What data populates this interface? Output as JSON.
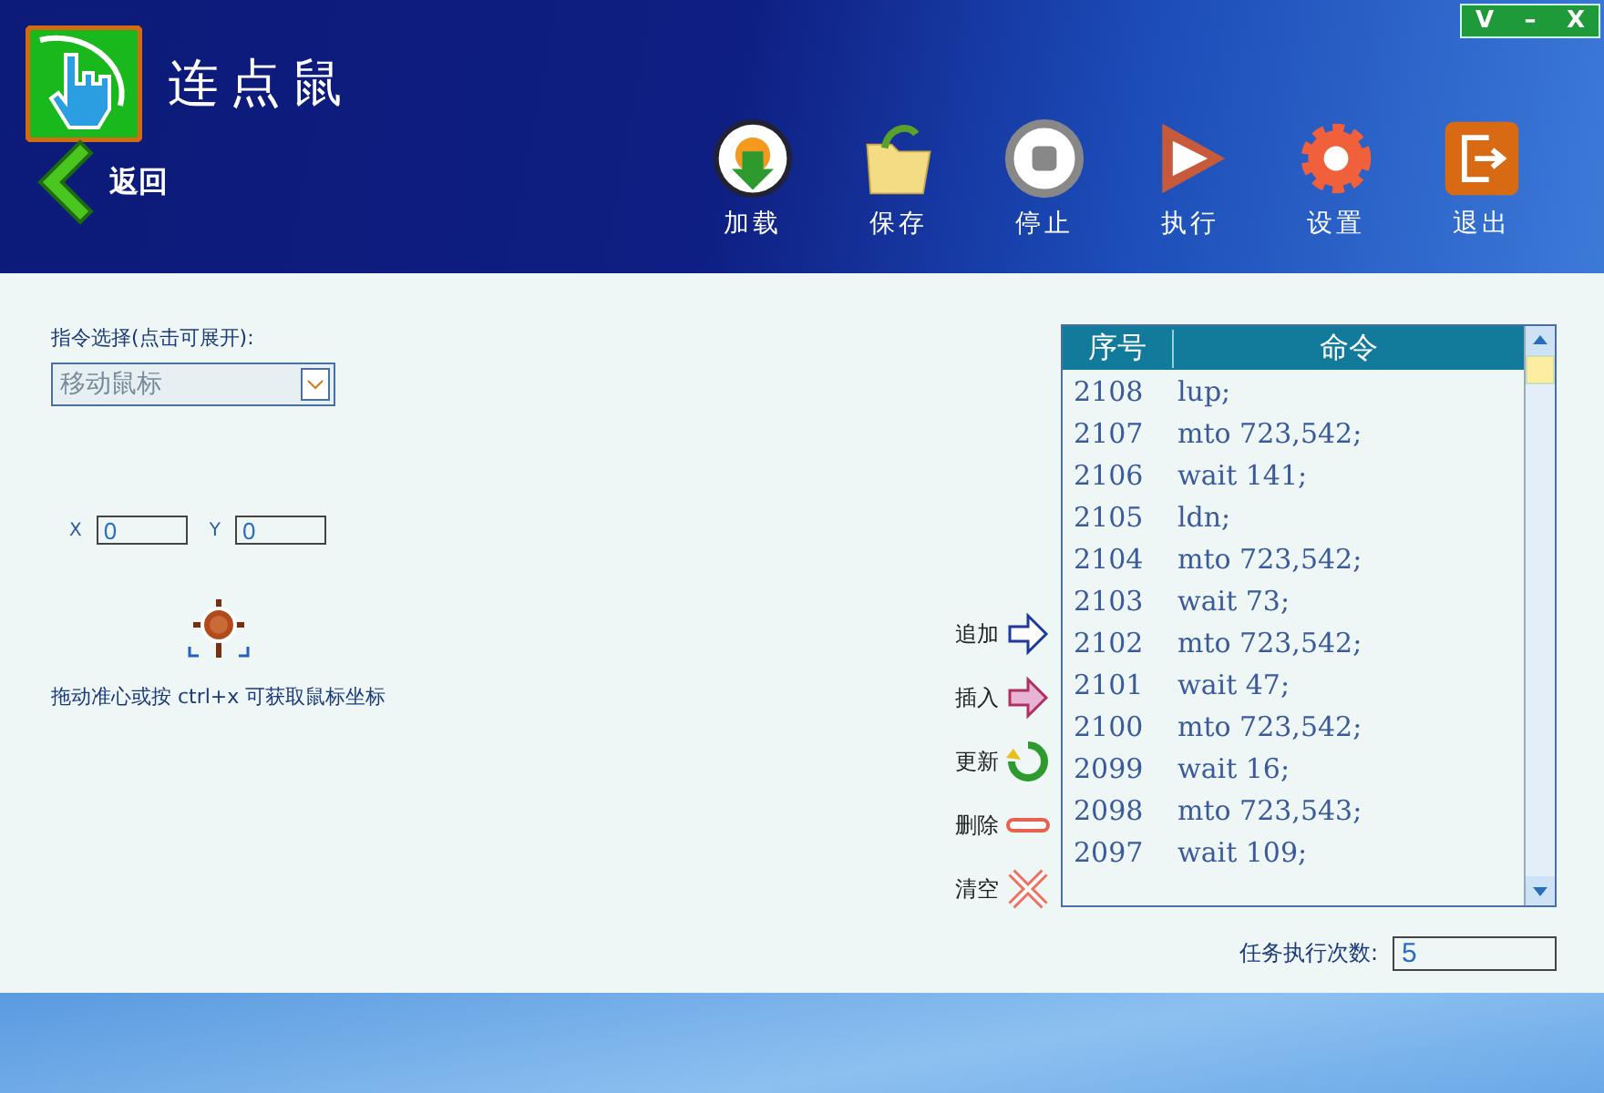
{
  "window": {
    "title": "连点鼠",
    "controls": [
      "V",
      "–",
      "X"
    ]
  },
  "back": {
    "label": "返回"
  },
  "toolbar": [
    {
      "kind": "load",
      "label": "加载"
    },
    {
      "kind": "save",
      "label": "保存"
    },
    {
      "kind": "stop",
      "label": "停止"
    },
    {
      "kind": "run",
      "label": "执行"
    },
    {
      "kind": "settings",
      "label": "设置"
    },
    {
      "kind": "exit",
      "label": "退出"
    }
  ],
  "command_select": {
    "label": "指令选择(点击可展开):",
    "value": "移动鼠标"
  },
  "coords": [
    {
      "label": "X",
      "value": "0"
    },
    {
      "label": "Y",
      "value": "0"
    }
  ],
  "hint": "拖动准心或按 ctrl+x 可获取鼠标坐标",
  "actions": [
    {
      "kind": "append",
      "label": "追加"
    },
    {
      "kind": "insert",
      "label": "插入"
    },
    {
      "kind": "update",
      "label": "更新"
    },
    {
      "kind": "delete",
      "label": "删除"
    },
    {
      "kind": "clear",
      "label": "清空"
    }
  ],
  "table": {
    "columns": [
      "序号",
      "命令"
    ],
    "rows": [
      [
        "2108",
        "lup;"
      ],
      [
        "2107",
        "mto 723,542;"
      ],
      [
        "2106",
        "wait 141;"
      ],
      [
        "2105",
        "ldn;"
      ],
      [
        "2104",
        "mto 723,542;"
      ],
      [
        "2103",
        "wait 73;"
      ],
      [
        "2102",
        "mto 723,542;"
      ],
      [
        "2101",
        "wait 47;"
      ],
      [
        "2100",
        "mto 723,542;"
      ],
      [
        "2099",
        "wait 16;"
      ],
      [
        "2098",
        "mto 723,543;"
      ],
      [
        "2097",
        "wait 109;"
      ]
    ]
  },
  "repeat": {
    "label": "任务执行次数:",
    "value": "5"
  }
}
